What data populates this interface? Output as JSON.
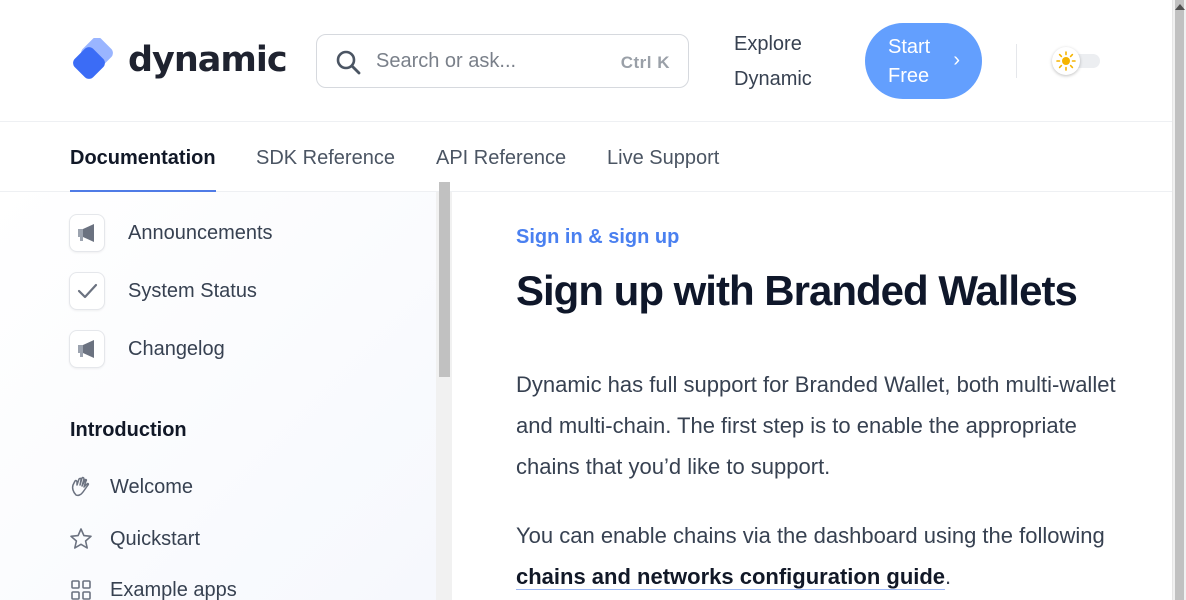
{
  "header": {
    "logo_text": "dynamic",
    "search": {
      "placeholder": "Search or ask...",
      "shortcut": "Ctrl K"
    },
    "explore_label": "Explore Dynamic",
    "start_button_label": "Start Free",
    "accent_color": "#639ffe"
  },
  "tabs": [
    {
      "label": "Documentation",
      "active": true
    },
    {
      "label": "SDK Reference",
      "active": false
    },
    {
      "label": "API Reference",
      "active": false
    },
    {
      "label": "Live Support",
      "active": false
    }
  ],
  "sidebar": {
    "top_links": [
      {
        "label": "Announcements",
        "icon": "megaphone-icon"
      },
      {
        "label": "System Status",
        "icon": "check-icon"
      },
      {
        "label": "Changelog",
        "icon": "megaphone-icon"
      }
    ],
    "section_heading": "Introduction",
    "items": [
      {
        "label": "Welcome",
        "icon": "waving-hand-icon"
      },
      {
        "label": "Quickstart",
        "icon": "star-icon"
      },
      {
        "label": "Example apps",
        "icon": "grid-icon"
      }
    ]
  },
  "content": {
    "eyebrow": "Sign in & sign up",
    "title": "Sign up with Branded Wallets",
    "paragraph_1": "Dynamic has full support for Branded Wallet, both multi-wallet and multi-chain. The first step is to enable the appropriate chains that you’d like to support.",
    "paragraph_2_prefix": "You can enable chains via the dashboard using the following ",
    "paragraph_2_link": "chains and networks configuration guide",
    "paragraph_2_suffix": "."
  }
}
